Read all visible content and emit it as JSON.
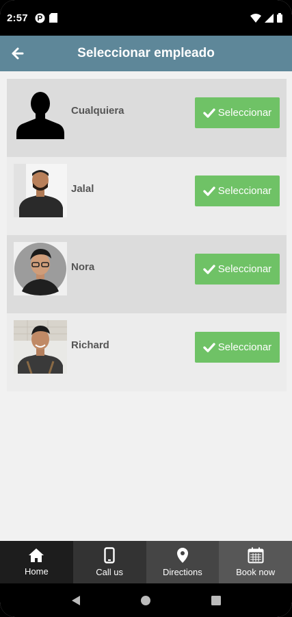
{
  "status_bar": {
    "time": "2:57"
  },
  "header": {
    "title": "Seleccionar empleado",
    "color": "#5e8799"
  },
  "employees": [
    {
      "name": "Cualquiera",
      "button_label": "Seleccionar",
      "avatar": "silhouette-avatar"
    },
    {
      "name": "Jalal",
      "button_label": "Seleccionar",
      "avatar": "photo-avatar"
    },
    {
      "name": "Nora",
      "button_label": "Seleccionar",
      "avatar": "photo-avatar"
    },
    {
      "name": "Richard",
      "button_label": "Seleccionar",
      "avatar": "photo-avatar"
    }
  ],
  "bottom_nav": [
    {
      "label": "Home",
      "icon": "home-icon"
    },
    {
      "label": "Call us",
      "icon": "phone-icon"
    },
    {
      "label": "Directions",
      "icon": "map-pin-icon"
    },
    {
      "label": "Book now",
      "icon": "calendar-icon"
    }
  ],
  "colors": {
    "accent_button": "#6fc266",
    "row_shaded": "#dcdcdc",
    "row_light": "#ececec"
  }
}
